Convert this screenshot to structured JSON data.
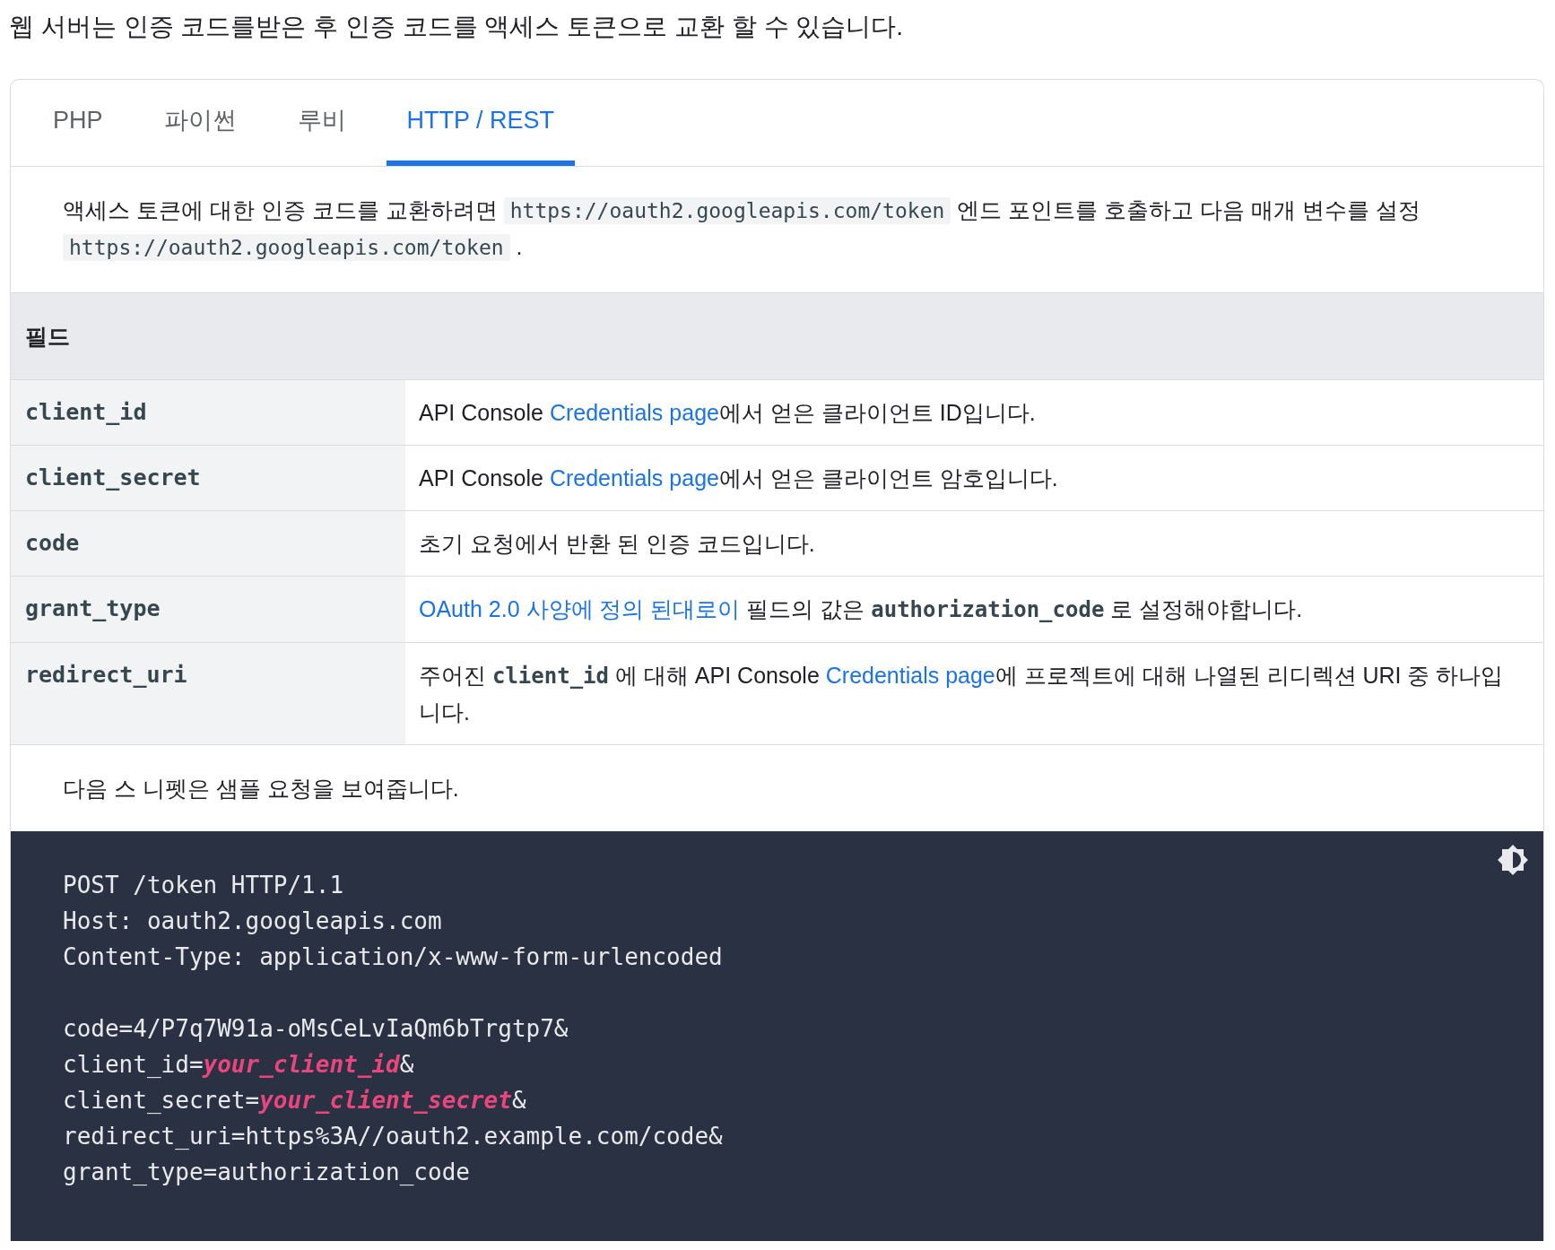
{
  "intro": "웹 서버는 인증 코드를받은 후 인증 코드를 액세스 토큰으로 교환 할 수 있습니다.",
  "tabs": [
    {
      "label": "PHP",
      "selected": false
    },
    {
      "label": "파이썬",
      "selected": false
    },
    {
      "label": "루비",
      "selected": false
    },
    {
      "label": "HTTP / REST",
      "selected": true
    }
  ],
  "description": [
    {
      "kind": "text",
      "text": "액세스 토큰에 대한 인증 코드를 교환하려면 "
    },
    {
      "kind": "code",
      "text": "https://oauth2.googleapis.com/token"
    },
    {
      "kind": "text",
      "text": " 엔드 포인트를 호출하고 다음 매개 변수를 설정 "
    },
    {
      "kind": "code",
      "text": "https://oauth2.googleapis.com/token"
    },
    {
      "kind": "text",
      "text": " ."
    }
  ],
  "table": {
    "header": "필드",
    "rows": [
      {
        "field": "client_id",
        "description": [
          {
            "kind": "text",
            "text": "API Console "
          },
          {
            "kind": "link",
            "text": "Credentials page"
          },
          {
            "kind": "text",
            "text": "에서 얻은 클라이언트 ID입니다."
          }
        ]
      },
      {
        "field": "client_secret",
        "description": [
          {
            "kind": "text",
            "text": "API Console "
          },
          {
            "kind": "link",
            "text": "Credentials page"
          },
          {
            "kind": "text",
            "text": "에서 얻은 클라이언트 암호입니다."
          }
        ]
      },
      {
        "field": "code",
        "description": [
          {
            "kind": "text",
            "text": "초기 요청에서 반환 된 인증 코드입니다."
          }
        ]
      },
      {
        "field": "grant_type",
        "description": [
          {
            "kind": "link",
            "text": "OAuth 2.0 사양에 정의 된대로이"
          },
          {
            "kind": "text",
            "text": " 필드의 값은 "
          },
          {
            "kind": "code",
            "text": "authorization_code"
          },
          {
            "kind": "text",
            "text": " 로 설정해야합니다."
          }
        ]
      },
      {
        "field": "redirect_uri",
        "description": [
          {
            "kind": "text",
            "text": "주어진 "
          },
          {
            "kind": "code",
            "text": "client_id"
          },
          {
            "kind": "text",
            "text": " 에 대해 API Console "
          },
          {
            "kind": "link",
            "text": "Credentials page"
          },
          {
            "kind": "text",
            "text": "에 프로젝트에 대해 나열된 리디렉션 URI 중 하나입니다."
          }
        ]
      }
    ]
  },
  "snippet_caption": "다음 스 니펫은 샘플 요청을 보여줍니다.",
  "code": {
    "header_lines": [
      "POST /token HTTP/1.1",
      "Host: oauth2.googleapis.com",
      "Content-Type: application/x-www-form-urlencoded"
    ],
    "body_lines": [
      [
        {
          "kind": "plain",
          "text": "code=4/P7q7W91a-oMsCeLvIaQm6bTrgtp7&"
        }
      ],
      [
        {
          "kind": "plain",
          "text": "client_id="
        },
        {
          "kind": "placeholder",
          "text": "your_client_id"
        },
        {
          "kind": "plain",
          "text": "&"
        }
      ],
      [
        {
          "kind": "plain",
          "text": "client_secret="
        },
        {
          "kind": "placeholder",
          "text": "your_client_secret"
        },
        {
          "kind": "plain",
          "text": "&"
        }
      ],
      [
        {
          "kind": "plain",
          "text": "redirect_uri=https%3A//oauth2.example.com/code&"
        }
      ],
      [
        {
          "kind": "plain",
          "text": "grant_type=authorization_code"
        }
      ]
    ]
  }
}
